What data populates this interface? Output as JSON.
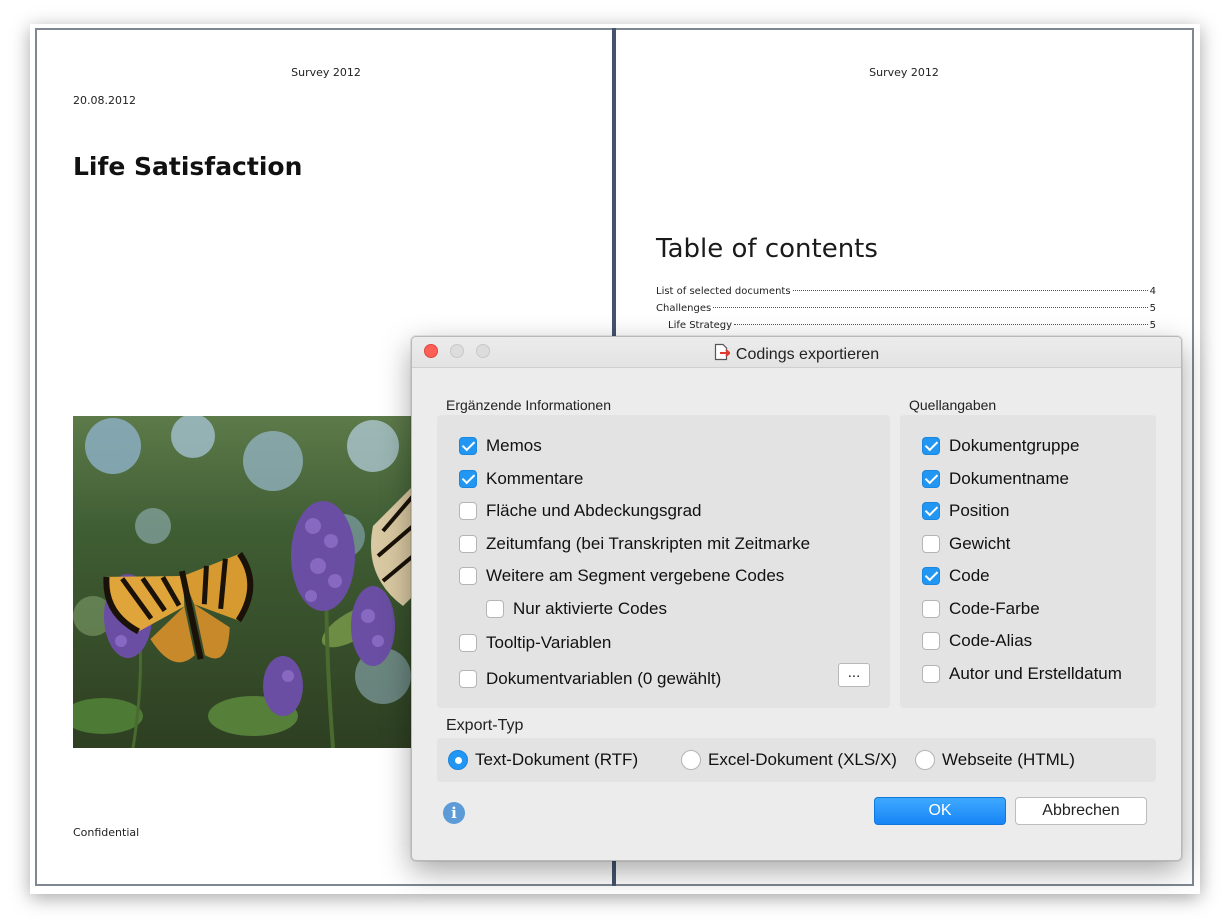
{
  "document": {
    "left_page": {
      "header": "Survey 2012",
      "date": "20.08.2012",
      "title": "Life Satisfaction",
      "footer": "Confidential"
    },
    "right_page": {
      "header": "Survey 2012",
      "toc_title": "Table of contents",
      "toc": [
        {
          "label": "List of selected documents",
          "page": "4"
        },
        {
          "label": "Challenges",
          "page": "5"
        },
        {
          "label": "Life Strategy",
          "page": "5"
        }
      ]
    }
  },
  "dialog": {
    "title": "Codings exportieren",
    "ergaenzende": {
      "label": "Ergänzende Informationen",
      "items": [
        {
          "label": "Memos",
          "checked": true
        },
        {
          "label": "Kommentare",
          "checked": true
        },
        {
          "label": "Fläche und Abdeckungsgrad",
          "checked": false
        },
        {
          "label": "Zeitumfang (bei Transkripten mit Zeitmarke",
          "checked": false
        },
        {
          "label": "Weitere am Segment vergebene Codes",
          "checked": false
        },
        {
          "label": "Nur aktivierte Codes",
          "checked": false
        },
        {
          "label": "Tooltip-Variablen",
          "checked": false
        },
        {
          "label": "Dokumentvariablen (0 gewählt)",
          "checked": false
        }
      ],
      "more_button": "..."
    },
    "quellangaben": {
      "label": "Quellangaben",
      "items": [
        {
          "label": "Dokumentgruppe",
          "checked": true
        },
        {
          "label": "Dokumentname",
          "checked": true
        },
        {
          "label": "Position",
          "checked": true
        },
        {
          "label": "Gewicht",
          "checked": false
        },
        {
          "label": "Code",
          "checked": true
        },
        {
          "label": "Code-Farbe",
          "checked": false
        },
        {
          "label": "Code-Alias",
          "checked": false
        },
        {
          "label": "Autor und Erstelldatum",
          "checked": false
        }
      ]
    },
    "export_typ": {
      "label": "Export-Typ",
      "options": [
        {
          "label": "Text-Dokument (RTF)",
          "selected": true
        },
        {
          "label": "Excel-Dokument (XLS/X)",
          "selected": false
        },
        {
          "label": "Webseite (HTML)",
          "selected": false
        }
      ]
    },
    "ok_label": "OK",
    "cancel_label": "Abbrechen",
    "info_glyph": "i",
    "accent_color": "#2196f3"
  }
}
